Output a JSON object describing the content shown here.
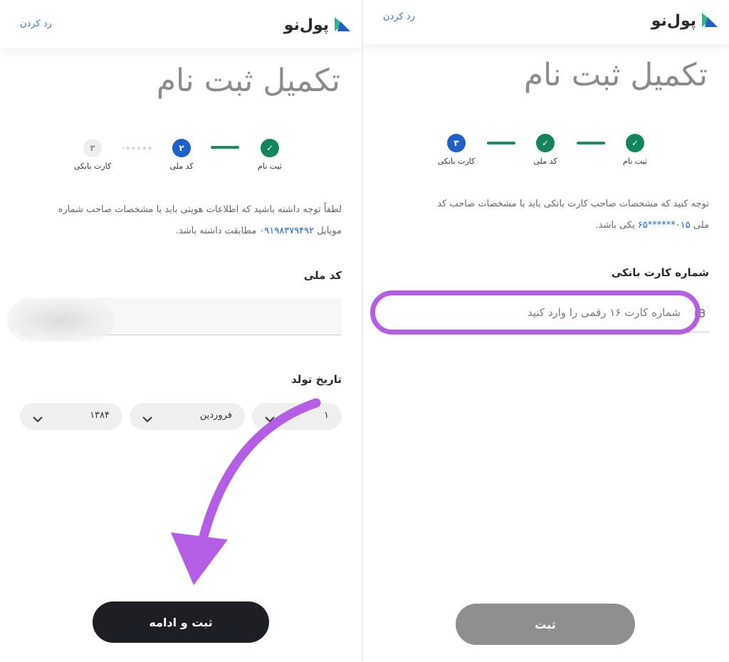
{
  "colors": {
    "accent_green": "#13855c",
    "accent_blue": "#1f5fc8",
    "highlight_purple": "#b45ee6",
    "link_blue": "#3d76c8"
  },
  "left": {
    "cancel": "رد کردن",
    "logo": "پول‌نو",
    "title": "تکمیل ثبت نام",
    "steps": [
      {
        "number": "",
        "label": "ثبت نام",
        "state": "done"
      },
      {
        "number": "۲",
        "label": "کد ملی",
        "state": "active"
      },
      {
        "number": "۳",
        "label": "کارت بانکی",
        "state": "pending"
      }
    ],
    "notice_line1": "لطفاً توجه داشته باشید که اطلاعات هویتی باید با مشخصات صاحب شماره",
    "notice_line2_prefix": "موبایل",
    "notice_phone": "۰۹۱۹۸۳۷۹۴۹۲",
    "notice_line2_suffix": "مطابقت داشته باشد.",
    "national_code_label": "کد ملی",
    "birth_label": "تاریخ تولد",
    "birth_day": "۱",
    "birth_month": "فروردین",
    "birth_year": "۱۳۸۴",
    "submit": "ثبت و ادامه"
  },
  "right": {
    "cancel": "رد کردن",
    "logo": "پول‌نو",
    "title": "تکمیل ثبت نام",
    "steps": [
      {
        "number": "",
        "label": "ثبت نام",
        "state": "done"
      },
      {
        "number": "",
        "label": "کد ملی",
        "state": "done"
      },
      {
        "number": "۳",
        "label": "کارت بانکی",
        "state": "active"
      }
    ],
    "notice_line1": "توجه کنید که مشخصات صاحب کارت بانکی باید با مشخصات صاحب کد",
    "notice_line2_prefix": "ملی",
    "notice_code": "۰۱۵******۶۵",
    "notice_line2_suffix": "یکی باشد.",
    "card_label": "شماره کارت بانکی",
    "card_placeholder": "شماره کارت ۱۶ رقمی را وارد کنید",
    "submit": "ثبت"
  }
}
